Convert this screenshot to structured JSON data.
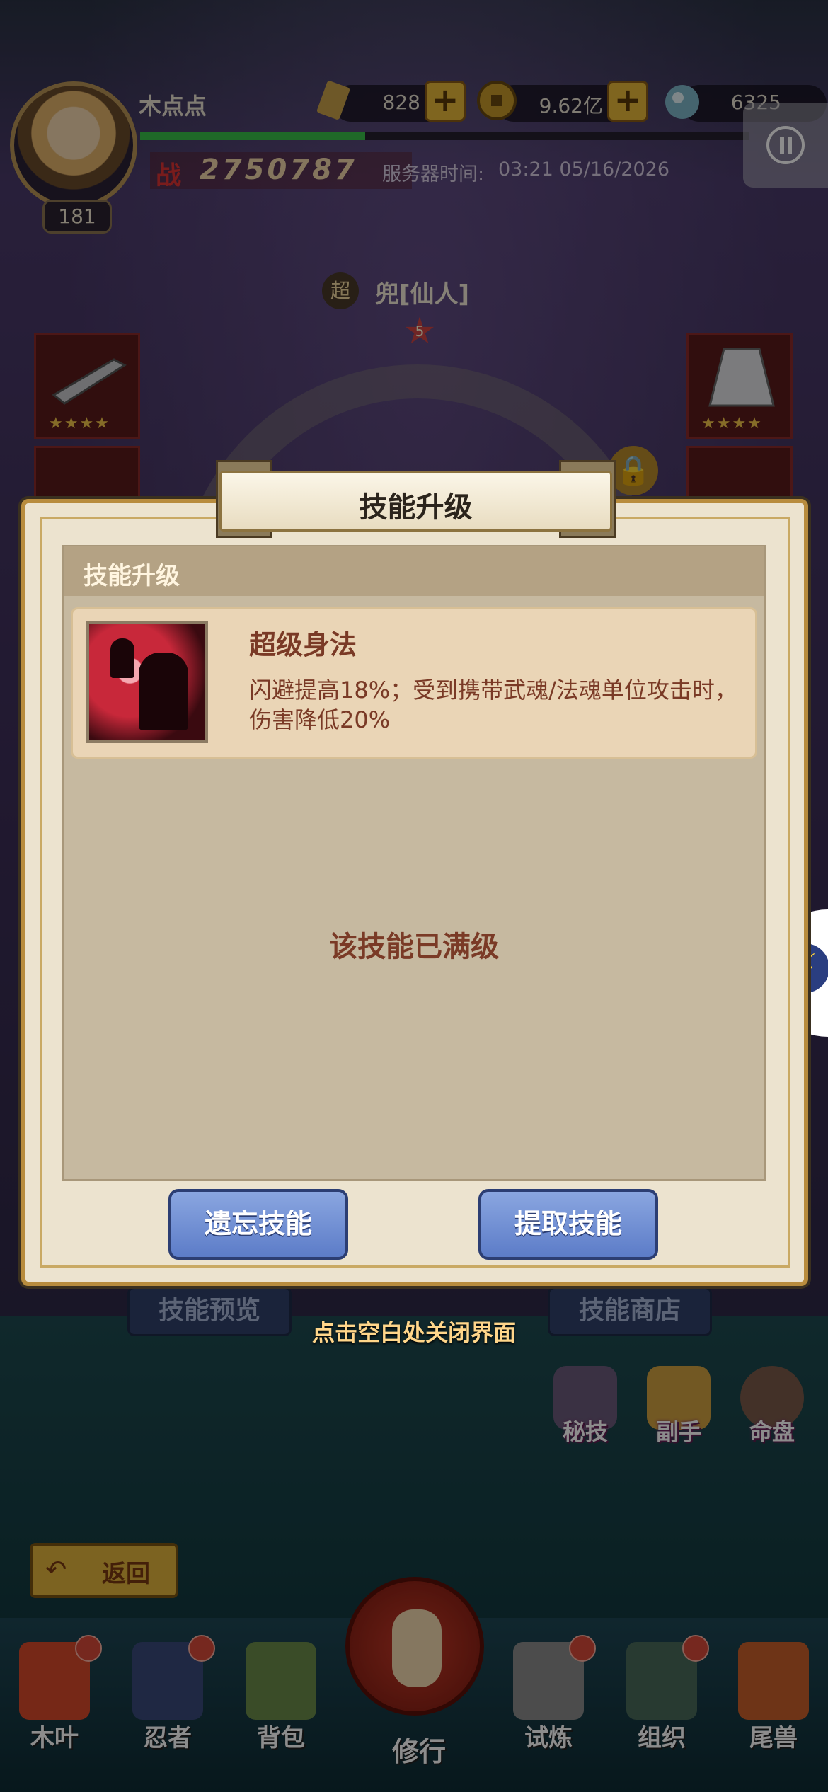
{
  "header": {
    "player_name": "木点点",
    "level": "181",
    "resources": [
      {
        "icon": "ticket-icon",
        "value": "828"
      },
      {
        "icon": "coin-icon",
        "value": "9.62亿"
      },
      {
        "icon": "crystal-icon",
        "value": "6325"
      }
    ],
    "power_value": "2750787",
    "server_time_label": "服务器时间:",
    "server_time": "03:21 05/16/2026",
    "xp_progress": 0.37
  },
  "hero": {
    "badge": "超",
    "name": "兜[仙人]",
    "star_level": "5",
    "equipment_stars": "★★★★"
  },
  "dialog": {
    "title": "技能升级",
    "panel_title": "技能升级",
    "skill": {
      "name": "超级身法",
      "description": "闪避提高18%；受到携带武魂/法魂单位攻击时，伤害降低20%"
    },
    "status": "该技能已满级",
    "forget_button": "遗忘技能",
    "extract_button": "提取技能"
  },
  "background": {
    "skill_preview": "技能预览",
    "skill_shop": "技能商店",
    "close_hint": "点击空白处关闭界面",
    "side_buttons": [
      "秘技",
      "副手",
      "命盘"
    ],
    "back": "返回"
  },
  "nav": {
    "items": [
      "木叶",
      "忍者",
      "背包",
      "修行",
      "试炼",
      "组织",
      "尾兽"
    ]
  },
  "colors": {
    "dialog_bg": "#ece3cf",
    "button_blue": "#5c7cc8",
    "text_brown": "#7a3a26",
    "accent_gold": "#e7b83a"
  }
}
